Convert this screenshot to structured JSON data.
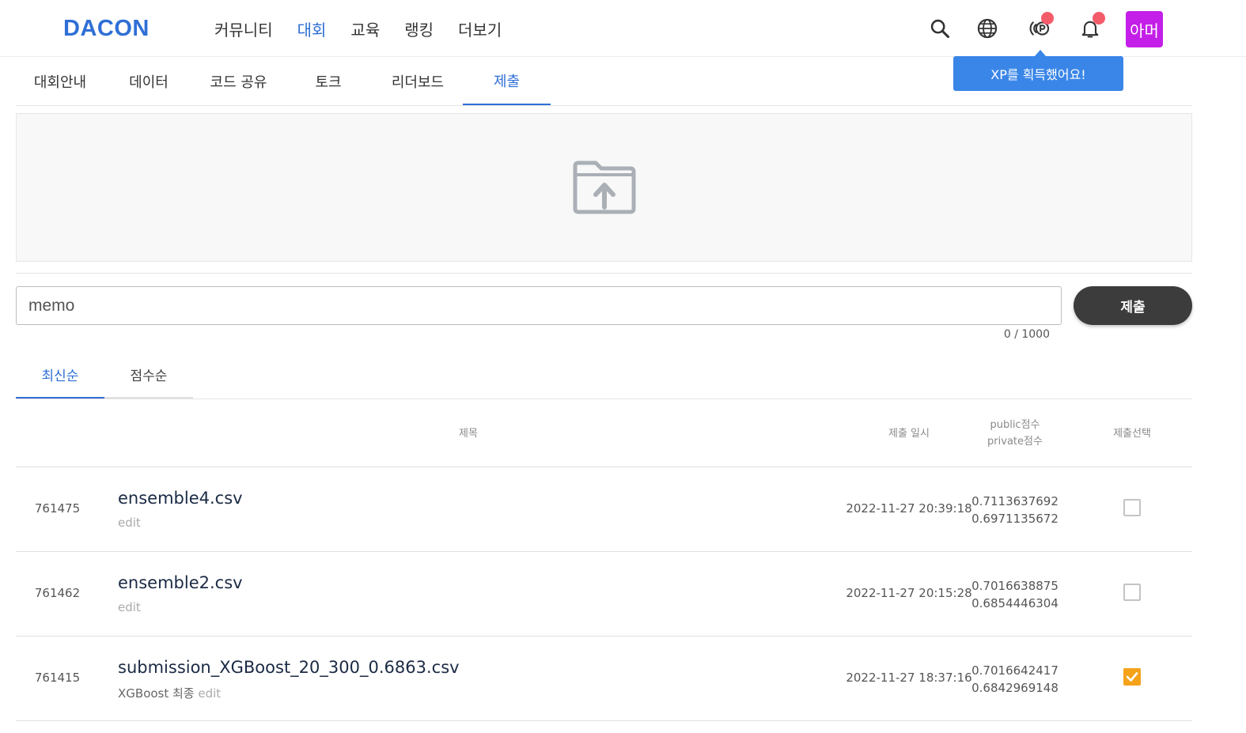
{
  "brand": {
    "logo": "DACON",
    "color": "#2f6fd6"
  },
  "main_nav": [
    "커뮤니티",
    "대회",
    "교육",
    "랭킹",
    "더보기"
  ],
  "main_nav_active": "대회",
  "header": {
    "icons": [
      "search-icon",
      "globe-icon",
      "xp-icon",
      "bell-icon"
    ],
    "avatar_text": "아머",
    "avatar_color": "#c41fe8",
    "tooltip": "XP를 획득했어요!"
  },
  "sub_tabs": [
    "대회안내",
    "데이터",
    "코드 공유",
    "토크",
    "리더보드",
    "제출"
  ],
  "sub_tab_active": "제출",
  "upload": {
    "icon": "folder-upload-icon"
  },
  "memo": {
    "placeholder": "memo",
    "value": "",
    "counter": "0 / 1000"
  },
  "submit_label": "제출",
  "sort_tabs": [
    "최신순",
    "점수순"
  ],
  "sort_active": "최신순",
  "table": {
    "headers": {
      "title": "제목",
      "date": "제출 일시",
      "public": "public점수",
      "private": "private점수",
      "select": "제출선택"
    },
    "rows": [
      {
        "id": "761475",
        "title": "ensemble4.csv",
        "memo": "",
        "edit": "edit",
        "date": "2022-11-27 20:39:18",
        "public": "0.7113637692",
        "private": "0.6971135672",
        "selected": false
      },
      {
        "id": "761462",
        "title": "ensemble2.csv",
        "memo": "",
        "edit": "edit",
        "date": "2022-11-27 20:15:28",
        "public": "0.7016638875",
        "private": "0.6854446304",
        "selected": false
      },
      {
        "id": "761415",
        "title": "submission_XGBoost_20_300_0.6863.csv",
        "memo": "XGBoost 최종",
        "edit": "edit",
        "date": "2022-11-27 18:37:16",
        "public": "0.7016642417",
        "private": "0.6842969148",
        "selected": true
      }
    ]
  },
  "colors": {
    "accent": "#2f6fd6",
    "checked": "#f5a21b",
    "notification": "#f45b69",
    "submit_button": "#3c3c3c"
  }
}
